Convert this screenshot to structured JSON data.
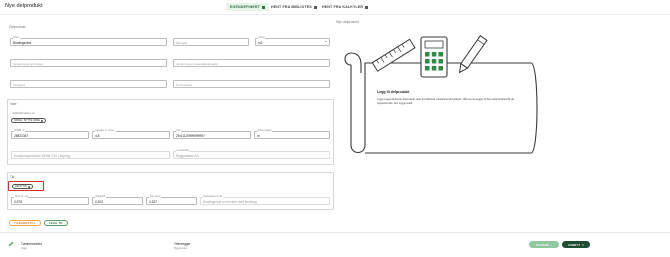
{
  "header": {
    "title": "Nye delprodukt",
    "tabs": [
      {
        "label": "EGENDEFINERT",
        "icon": "copy-icon",
        "active": true
      },
      {
        "label": "HENT FRA BIBLIOTEK",
        "icon": "book-icon",
        "active": false
      },
      {
        "label": "HENT FRA KALKYLER",
        "icon": "calculator-icon",
        "active": false
      }
    ]
  },
  "form": {
    "section_label": "Delprodukt",
    "navn": {
      "caption": "Navn",
      "value": "Bindingsverk"
    },
    "mengde": {
      "placeholder": "Mengde"
    },
    "enhet": {
      "caption": "Enhet",
      "value": "m2"
    },
    "justering_grunnlag": {
      "placeholder": "Justering av grunnlag"
    },
    "justering_materialkostnader": {
      "placeholder": "Justering av materialkostnader"
    },
    "utregnet": {
      "placeholder": "Utregnet"
    },
    "kommentar": {
      "placeholder": "Kommentar"
    },
    "vare": {
      "heading": "Vare",
      "product_link": "nobbforbrukere.no",
      "chip_label": "FINNE / BYTTE VARE",
      "nobb_nr": {
        "caption": "NOBB nr.",
        "value": "25831367"
      },
      "mengde_per_enhet": {
        "caption": "Mengde pr. enhet",
        "value": "4,8"
      },
      "pris": {
        "caption": "Pris",
        "value": "29,61119999999997"
      },
      "enhet": {
        "caption": "Enhet (salgs)",
        "value": "m"
      },
      "beskrivelse": {
        "value": "Konstruksjonsvirke 48x98 C24 / Impreg."
      },
      "leverandor": {
        "caption": "Leverandør",
        "value": "Byggmakker AS"
      }
    },
    "tid": {
      "heading": "Tid",
      "chip_label": "HENT TID",
      "timer": {
        "caption": "Timer pr. m2",
        "value": "0,578"
      },
      "rigg": {
        "caption": "Rigg/drift",
        "value": "0,203"
      },
      "sum": {
        "caption": "Sum timer",
        "value": "0,337"
      },
      "info": {
        "caption": "Beskrivelse av tid",
        "value": "Bindingsverk av trevirke med kledning"
      }
    },
    "actions": {
      "cancel_label": "TILBAKESTILL",
      "add_label": "LEGG TIL"
    }
  },
  "preview": {
    "heading": "Nye delprodukt",
    "empty_title": "Legg til delprodukt",
    "empty_text": "Legg til egendefinerte delprodukt, eller fra bibliotek i eksisterende kalkyler. Når kun du legger til flere delprodukter får du oppsettet ditt i den byggmodell."
  },
  "footer": {
    "item_title": "Tømmerarbeid",
    "item_sub": "Vegg",
    "item2_title": "Yttervegger",
    "item2_sub": "Byggmodell",
    "btn_back": "TILBAKE",
    "btn_close": "AVBRYT"
  },
  "colors": {
    "accent_green": "#2e6b3f",
    "light_green": "#8fc79f",
    "dark_green": "#1f4d32",
    "highlight_red": "#d32f2f",
    "orange": "#d07a10"
  }
}
